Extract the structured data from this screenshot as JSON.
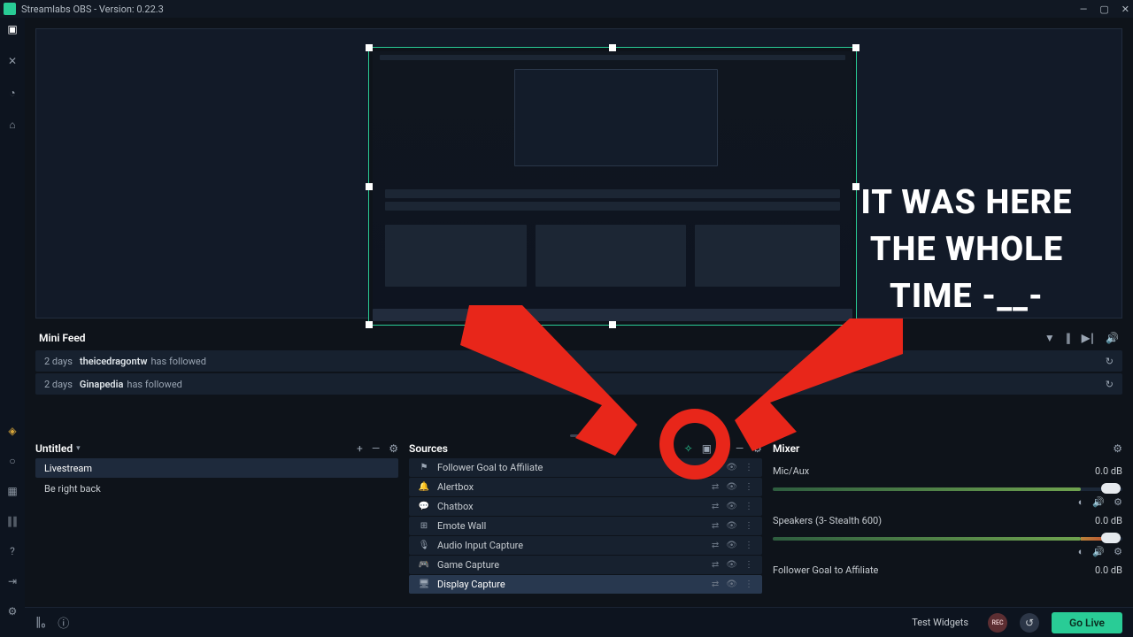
{
  "titlebar": {
    "title": "Streamlabs OBS - Version: 0.22.3"
  },
  "overlay_text": "IT WAS HERE THE WHOLE TIME -__-",
  "mini_feed": {
    "title": "Mini Feed",
    "items": [
      {
        "age": "2 days",
        "user": "theicedragontw",
        "action": "has followed"
      },
      {
        "age": "2 days",
        "user": "Ginapedia",
        "action": "has followed"
      }
    ]
  },
  "scenes": {
    "collection": "Untitled",
    "items": [
      "Livestream",
      "Be right back"
    ],
    "active_index": 0
  },
  "sources": {
    "title": "Sources",
    "items": [
      {
        "icon": "flag-icon",
        "glyph": "⚑",
        "label": "Follower Goal to Affiliate"
      },
      {
        "icon": "bell-icon",
        "glyph": "🔔",
        "label": "Alertbox"
      },
      {
        "icon": "chat-icon",
        "glyph": "💬",
        "label": "Chatbox"
      },
      {
        "icon": "grid-icon",
        "glyph": "⊞",
        "label": "Emote Wall"
      },
      {
        "icon": "mic-icon",
        "glyph": "🎙",
        "label": "Audio Input Capture"
      },
      {
        "icon": "gamepad-icon",
        "glyph": "🎮",
        "label": "Game Capture"
      },
      {
        "icon": "monitor-icon",
        "glyph": "🖥",
        "label": "Display Capture"
      }
    ],
    "selected_index": 6
  },
  "mixer": {
    "title": "Mixer",
    "items": [
      {
        "label": "Mic/Aux",
        "db": "0.0 dB",
        "controls": true
      },
      {
        "label": "Speakers (3- Stealth 600)",
        "db": "0.0 dB",
        "controls": true,
        "warn": true
      },
      {
        "label": "Follower Goal to Affiliate",
        "db": "0.0 dB",
        "controls": false
      }
    ]
  },
  "footer": {
    "test_widgets": "Test Widgets",
    "rec": "REC",
    "go_live": "Go Live"
  }
}
